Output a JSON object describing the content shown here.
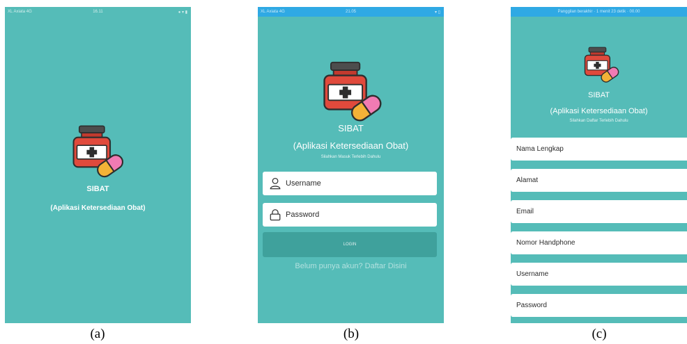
{
  "colors": {
    "screen_bg": "#55bcb8",
    "status_bar_blue": "#2fa9e4",
    "button_bg": "#3fa19c",
    "field_bg": "#ffffff"
  },
  "screens": [
    {
      "caption": "(a)",
      "status": {
        "left": "XL Axiata 4G",
        "center": "16.11",
        "right": "● ▾ ▮"
      },
      "logo_icon": "medicine-bottle-pill-icon",
      "title": "SIBAT",
      "subtitle": "(Aplikasi Ketersediaan Obat)"
    },
    {
      "caption": "(b)",
      "status": {
        "left": "XL Axiata 4G",
        "center": "21.05",
        "right": "▾ ▯"
      },
      "logo_icon": "medicine-bottle-pill-icon",
      "title": "SIBAT",
      "subtitle": "(Aplikasi Ketersediaan Obat)",
      "hint": "Silahkan Masuk Terlebih Dahulu",
      "fields": [
        {
          "icon": "user-icon",
          "placeholder": "Username"
        },
        {
          "icon": "lock-icon",
          "placeholder": "Password"
        }
      ],
      "login_button": "LOGIN",
      "signup_link": "Belum punya akun? Daftar Disini"
    },
    {
      "caption": "(c)",
      "status": {
        "center": "Panggilan berakhir · 1 menit 23 detik · 00.00"
      },
      "logo_icon": "medicine-bottle-pill-icon",
      "title": "SIBAT",
      "subtitle": "(Aplikasi Ketersediaan Obat)",
      "hint": "Silahkan Daftar Terlebih Dahulu",
      "fields": [
        {
          "placeholder": "Nama Lengkap"
        },
        {
          "placeholder": "Alamat"
        },
        {
          "placeholder": "Email"
        },
        {
          "placeholder": "Nomor Handphone"
        },
        {
          "placeholder": "Username"
        },
        {
          "placeholder": "Password"
        }
      ]
    }
  ]
}
